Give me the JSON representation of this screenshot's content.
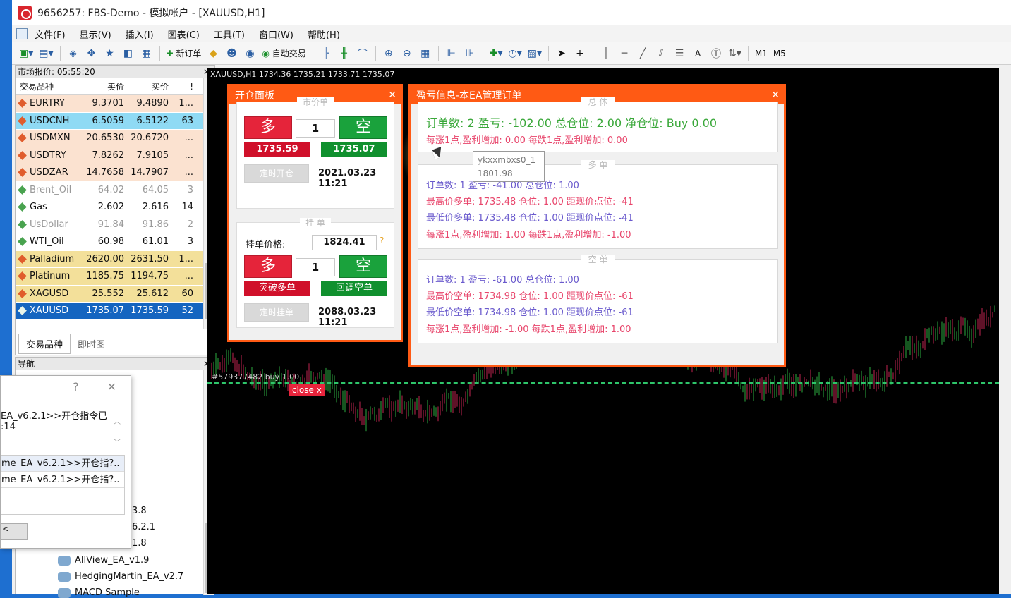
{
  "window": {
    "title": "9656257: FBS-Demo - 模拟帐户 - [XAUUSD,H1]"
  },
  "menu": [
    "文件(F)",
    "显示(V)",
    "插入(I)",
    "图表(C)",
    "工具(T)",
    "窗口(W)",
    "帮助(H)"
  ],
  "toolbar": {
    "new_order": "新订单",
    "auto_trade": "自动交易",
    "m1": "M1",
    "m5": "M5",
    "text_tool": "A",
    "plus": "+"
  },
  "market_watch": {
    "title": "市场报价: 05:55:20",
    "col_symbol": "交易品种",
    "col_bid": "卖价",
    "col_ask": "买价",
    "col_spread": "!",
    "rows": [
      {
        "symbol": "EURTRY",
        "bid": "9.3701",
        "ask": "9.4890",
        "spread": "1...",
        "bg": "#fbe2d0",
        "color": "#111"
      },
      {
        "symbol": "USDCNH",
        "bid": "6.5059",
        "ask": "6.5122",
        "spread": "63",
        "bg": "#8fdaf4",
        "color": "#111"
      },
      {
        "symbol": "USDMXN",
        "bid": "20.6530",
        "ask": "20.6720",
        "spread": "...",
        "bg": "#fbe2d0",
        "color": "#111"
      },
      {
        "symbol": "USDTRY",
        "bid": "7.8262",
        "ask": "7.9105",
        "spread": "...",
        "bg": "#fbe2d0",
        "color": "#111"
      },
      {
        "symbol": "USDZAR",
        "bid": "14.7658",
        "ask": "14.7907",
        "spread": "...",
        "bg": "#fbe2d0",
        "color": "#111"
      },
      {
        "symbol": "Brent_Oil",
        "bid": "64.02",
        "ask": "64.05",
        "spread": "3",
        "bg": "#fff",
        "color": "#999"
      },
      {
        "symbol": "Gas",
        "bid": "2.602",
        "ask": "2.616",
        "spread": "14",
        "bg": "#fff",
        "color": "#111"
      },
      {
        "symbol": "UsDollar",
        "bid": "91.84",
        "ask": "91.86",
        "spread": "2",
        "bg": "#fff",
        "color": "#999"
      },
      {
        "symbol": "WTI_Oil",
        "bid": "60.98",
        "ask": "61.01",
        "spread": "3",
        "bg": "#fff",
        "color": "#111"
      },
      {
        "symbol": "Palladium",
        "bid": "2620.00",
        "ask": "2631.50",
        "spread": "1...",
        "bg": "#f3e09a",
        "color": "#111"
      },
      {
        "symbol": "Platinum",
        "bid": "1185.75",
        "ask": "1194.75",
        "spread": "...",
        "bg": "#f3e09a",
        "color": "#111"
      },
      {
        "symbol": "XAGUSD",
        "bid": "25.552",
        "ask": "25.612",
        "spread": "60",
        "bg": "#f3e09a",
        "color": "#111"
      },
      {
        "symbol": "XAUUSD",
        "bid": "1735.07",
        "ask": "1735.59",
        "spread": "52",
        "bg": "#1565c0",
        "color": "#fff"
      }
    ],
    "tab_symbols": "交易品种",
    "tab_tick": "即时图"
  },
  "navigator": {
    "title": "导航",
    "items": [
      "AllView_EA_v1.9",
      "HedgingMartin_EA_v2.7",
      "MACD Sample"
    ],
    "partial": [
      "3.8",
      "6.2.1",
      "1.8"
    ]
  },
  "dialog": {
    "help": "?",
    "close": "✕",
    "message_line1": "EA_v6.2.1>>开仓指令已",
    "message_line2": ":14",
    "list": [
      "me_EA_v6.2.1>>开仓指?..",
      "me_EA_v6.2.1>>开仓指?.."
    ],
    "button": "<"
  },
  "chart": {
    "info": "XAUUSD,H1  1734.36 1735.21 1733.71 1735.07",
    "line_label": "#579377482 buy 1.00",
    "close_tag": "close x"
  },
  "open_panel": {
    "title": "开仓面板",
    "market_group": "市价单",
    "long": "多",
    "short": "空",
    "lots": "1",
    "buy_price": "1735.59",
    "sell_price": "1735.07",
    "timed_open": "定时开仓",
    "time1": "2021.03.23 11:21",
    "pending_group": "挂 单",
    "pending_label": "挂单价格:",
    "pending_price": "1824.41",
    "pending_hint": "?",
    "long2": "多",
    "short2": "空",
    "lots2": "1",
    "breakout_buy": "突破多单",
    "pullback_sell": "回调空单",
    "timed_pending": "定时挂单",
    "time2": "2088.03.23 11:21"
  },
  "info_panel": {
    "title": "盈亏信息-本EA管理订单",
    "total_group": "总 体",
    "total_line": "订单数: 2  盈亏: -102.00  总仓位: 2.00  净仓位: Buy 0.00",
    "total_line2": "每涨1点,盈利增加: 0.00    每跌1点,盈利增加: 0.00",
    "long_group": "多 单",
    "long_lines": [
      "订单数: 1  盈亏: -41.00  总仓位: 1.00",
      "最高价多单: 1735.48  仓位: 1.00  距现价点位: -41",
      "最低价多单: 1735.48  仓位: 1.00  距现价点位: -41",
      "每涨1点,盈利增加: 1.00    每跌1点,盈利增加: -1.00"
    ],
    "short_group": "空 单",
    "short_lines": [
      "订单数: 1  盈亏: -61.00  总仓位: 1.00",
      "最高价空单: 1734.98  仓位: 1.00  距现价点位: -61",
      "最低价空单: 1734.98  仓位: 1.00  距现价点位: -61",
      "每涨1点,盈利增加: -1.00    每跌1点,盈利增加: 1.00"
    ],
    "tooltip_line1": "ykxxmbxs0_1",
    "tooltip_line2": "1801.98"
  },
  "colors": {
    "panel_accent": "#ff5a14",
    "buy_red": "#e5243a",
    "sell_green": "#1aa23c"
  }
}
